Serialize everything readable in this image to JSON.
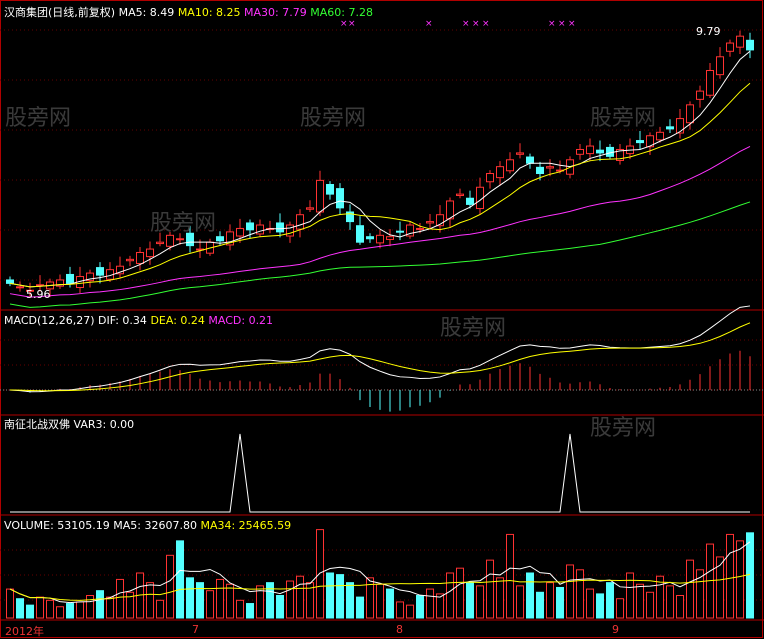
{
  "header": {
    "title": "汉商集团(日线,前复权)",
    "ma5": "MA5: 8.49",
    "ma10": "MA10: 8.25",
    "ma30": "MA30: 7.79",
    "ma60": "MA60: 7.28",
    "high_label": "9.79",
    "low_label": "5.96"
  },
  "macd": {
    "title": "MACD(12,26,27)",
    "dif": "DIF: 0.34",
    "dea": "DEA: 0.24",
    "macd": "MACD: 0.21"
  },
  "var3": {
    "title": "南征北战双佛",
    "value": "VAR3: 0.00",
    "spikes": [
      23,
      56
    ]
  },
  "volume": {
    "title": "VOLUME: 53105.19",
    "ma5": "MA5: 32607.80",
    "ma34": "MA34: 25465.59"
  },
  "xaxis": {
    "labels": [
      "2012年",
      "7",
      "8",
      "9"
    ]
  },
  "watermark": "股旁网",
  "colors": {
    "up": "#ff3232",
    "down": "#54ffff",
    "border": "#b00000"
  },
  "chart_data": {
    "type": "candlestick",
    "ylim": [
      5.96,
      9.79
    ],
    "close": [
      6.1,
      6.05,
      6.0,
      6.08,
      6.12,
      6.15,
      6.1,
      6.2,
      6.25,
      6.22,
      6.3,
      6.35,
      6.45,
      6.55,
      6.6,
      6.7,
      6.8,
      6.75,
      6.65,
      6.6,
      6.7,
      6.72,
      6.85,
      6.9,
      6.88,
      6.95,
      6.9,
      6.85,
      6.95,
      7.1,
      7.2,
      7.6,
      7.4,
      7.2,
      7.0,
      6.7,
      6.75,
      6.8,
      6.78,
      6.85,
      6.95,
      6.9,
      7.0,
      7.1,
      7.3,
      7.4,
      7.25,
      7.5,
      7.7,
      7.8,
      7.9,
      8.0,
      7.85,
      7.7,
      7.8,
      7.75,
      7.9,
      8.05,
      8.1,
      8.0,
      7.95,
      8.05,
      8.1,
      8.15,
      8.25,
      8.3,
      8.35,
      8.5,
      8.7,
      8.9,
      9.2,
      9.4,
      9.6,
      9.7,
      9.5
    ],
    "volume": [
      18000,
      12000,
      8000,
      13000,
      11000,
      7000,
      9000,
      10000,
      14000,
      17000,
      13000,
      24000,
      16000,
      28000,
      22000,
      11000,
      39000,
      48000,
      25000,
      22000,
      17000,
      24000,
      21000,
      11000,
      9000,
      20000,
      22000,
      14000,
      23000,
      26000,
      22000,
      55000,
      28000,
      27000,
      22000,
      13000,
      25000,
      21000,
      18000,
      10000,
      8000,
      14000,
      18000,
      15000,
      28000,
      31000,
      22000,
      20000,
      36000,
      25000,
      52000,
      20000,
      28000,
      16000,
      22000,
      19000,
      33000,
      30000,
      18000,
      15000,
      22000,
      12000,
      28000,
      21000,
      16000,
      26000,
      20000,
      14000,
      36000,
      30000,
      46000,
      38000,
      52000,
      48000,
      53000
    ]
  }
}
